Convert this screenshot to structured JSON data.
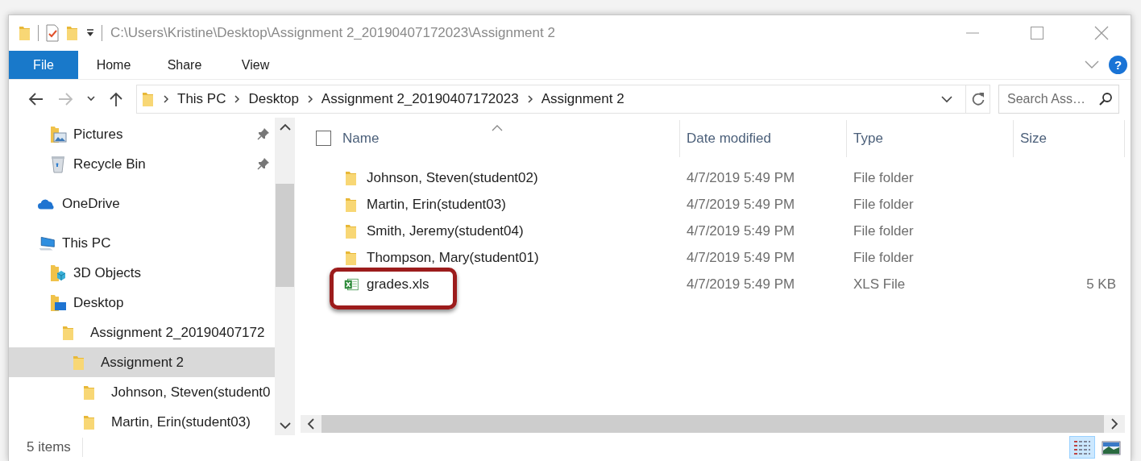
{
  "window": {
    "title": "C:\\Users\\Kristine\\Desktop\\Assignment 2_20190407172023\\Assignment 2"
  },
  "ribbon": {
    "tabs": [
      {
        "label": "File",
        "kind": "backstage"
      },
      {
        "label": "Home",
        "kind": "tab"
      },
      {
        "label": "Share",
        "kind": "tab"
      },
      {
        "label": "View",
        "kind": "tab"
      }
    ],
    "help": "?"
  },
  "nav_buttons": [
    {
      "kind": "back",
      "disabled": false
    },
    {
      "kind": "forward",
      "disabled": true
    },
    {
      "kind": "recent",
      "disabled": false
    },
    {
      "kind": "up",
      "disabled": false
    }
  ],
  "address": {
    "breadcrumbs": [
      "This PC",
      "Desktop",
      "Assignment 2_20190407172023",
      "Assignment 2"
    ]
  },
  "search": {
    "placeholder": "Search Ass…"
  },
  "nav_pane": {
    "items": [
      {
        "label": "Pictures",
        "kind": "pictures",
        "pinned": true,
        "selected": false
      },
      {
        "label": "Recycle Bin",
        "kind": "recycle",
        "pinned": true,
        "selected": false
      },
      {
        "label": "OneDrive",
        "kind": "cloud",
        "selected": false
      },
      {
        "label": "This PC",
        "kind": "pc",
        "selected": false,
        "children": [
          {
            "label": "3D Objects",
            "kind": "objects",
            "selected": false
          },
          {
            "label": "Desktop",
            "kind": "desktop",
            "selected": false,
            "children": [
              {
                "label": "Assignment 2_20190407172",
                "kind": "folder",
                "selected": false,
                "children": [
                  {
                    "label": "Assignment 2",
                    "kind": "folder",
                    "selected": true,
                    "children": [
                      {
                        "label": "Johnson, Steven(student0",
                        "kind": "folder",
                        "selected": false
                      },
                      {
                        "label": "Martin, Erin(student03)",
                        "kind": "folder",
                        "selected": false
                      }
                    ]
                  }
                ]
              }
            ]
          }
        ]
      }
    ]
  },
  "file_list": {
    "columns": [
      "Name",
      "Date modified",
      "Type",
      "Size"
    ],
    "select_all": {
      "checked": false
    },
    "rows": [
      {
        "name": "Johnson, Steven(student02)",
        "date": "4/7/2019 5:49 PM",
        "type": "File folder",
        "kind": "folder",
        "highlighted": false
      },
      {
        "name": "Martin, Erin(student03)",
        "date": "4/7/2019 5:49 PM",
        "type": "File folder",
        "kind": "folder",
        "highlighted": false
      },
      {
        "name": "Smith, Jeremy(student04)",
        "date": "4/7/2019 5:49 PM",
        "type": "File folder",
        "kind": "folder",
        "highlighted": false
      },
      {
        "name": "Thompson, Mary(student01)",
        "date": "4/7/2019 5:49 PM",
        "type": "File folder",
        "kind": "folder",
        "highlighted": false
      },
      {
        "name": "grades.xls",
        "date": "4/7/2019 5:49 PM",
        "type": "XLS File",
        "size": "5 KB",
        "kind": "spreadsheet",
        "highlighted": true
      }
    ]
  },
  "status_bar": {
    "item_count": "5 items",
    "views": [
      {
        "kind": "details",
        "selected": true
      },
      {
        "kind": "large_icons",
        "selected": false
      }
    ]
  }
}
